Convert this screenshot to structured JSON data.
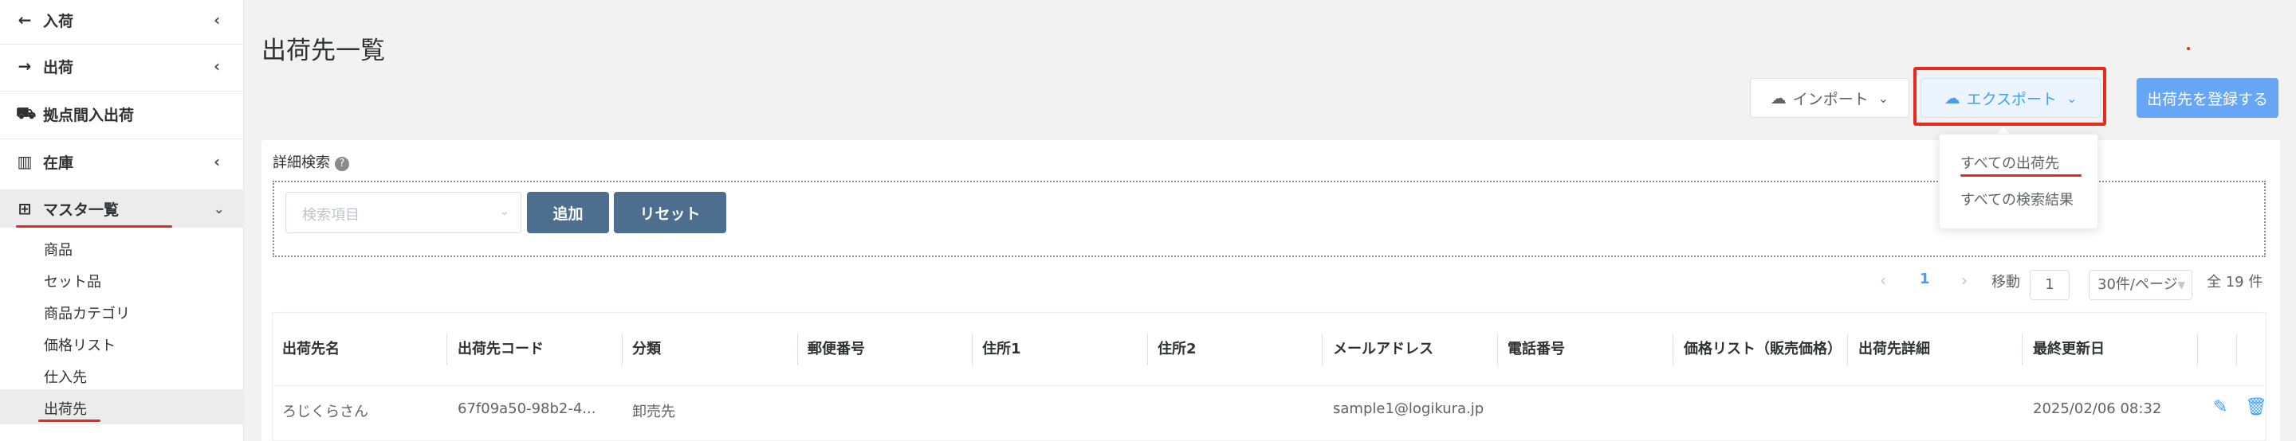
{
  "sidebar": {
    "items": [
      {
        "label": "入荷",
        "icon": "arrow-left-icon"
      },
      {
        "label": "出荷",
        "icon": "arrow-right-icon"
      },
      {
        "label": "拠点間入出荷",
        "icon": "truck-icon"
      },
      {
        "label": "在庫",
        "icon": "warehouse-icon"
      },
      {
        "label": "マスタ一覧",
        "icon": "grid-icon"
      }
    ],
    "sub_items": [
      "商品",
      "セット品",
      "商品カテゴリ",
      "価格リスト",
      "仕入先",
      "出荷先"
    ]
  },
  "page": {
    "title": "出荷先一覧"
  },
  "toolbar": {
    "import_label": "インポート",
    "export_label": "エクスポート",
    "register_label": "出荷先を登録する"
  },
  "export_menu": {
    "items": [
      "すべての出荷先",
      "すべての検索結果"
    ]
  },
  "search": {
    "title": "詳細検索",
    "help": "?",
    "placeholder": "検索項目",
    "add_label": "追加",
    "reset_label": "リセット"
  },
  "pagination": {
    "current_page": "1",
    "move_label": "移動",
    "goto_value": "1",
    "page_size": "30件/ページ",
    "total": "全 19 件"
  },
  "table": {
    "headers": [
      "出荷先名",
      "出荷先コード",
      "分類",
      "郵便番号",
      "住所1",
      "住所2",
      "メールアドレス",
      "電話番号",
      "価格リスト（販売価格）",
      "出荷先詳細",
      "最終更新日"
    ],
    "rows": [
      {
        "name": "ろじくらさん",
        "code": "67f09a50-98b2-4...",
        "category": "卸売先",
        "postal": "",
        "address1": "",
        "address2": "",
        "email": "sample1@logikura.jp",
        "phone": "",
        "price_list": "",
        "detail": "",
        "updated": "2025/02/06 08:32"
      }
    ]
  },
  "colors": {
    "accent": "#409eff",
    "highlight": "#e62b1e",
    "button_dark": "#4d6e8f"
  }
}
